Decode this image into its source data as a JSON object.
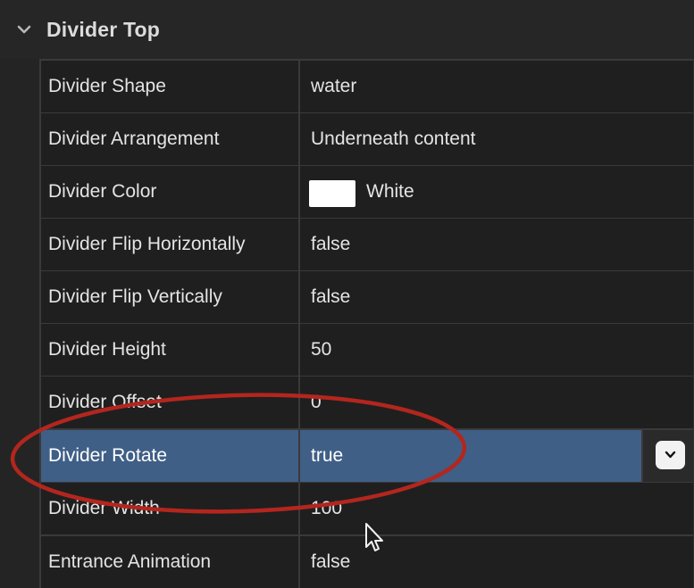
{
  "section": {
    "title": "Divider Top",
    "icon": "chevron-down-icon"
  },
  "properties": [
    {
      "name": "Divider Shape",
      "value": "water"
    },
    {
      "name": "Divider Arrangement",
      "value": "Underneath content"
    },
    {
      "name": "Divider Color",
      "value": "White",
      "swatch_color": "#ffffff"
    },
    {
      "name": "Divider Flip Horizontally",
      "value": "false"
    },
    {
      "name": "Divider Flip Vertically",
      "value": "false"
    },
    {
      "name": "Divider Height",
      "value": "50"
    },
    {
      "name": "Divider Offset",
      "value": "0"
    },
    {
      "name": "Divider Rotate",
      "value": "true",
      "selected": true,
      "control": "dropdown-chevron-icon"
    },
    {
      "name": "Divider Width",
      "value": "100"
    },
    {
      "name": "Entrance Animation",
      "value": "false"
    }
  ],
  "colors": {
    "selection": "#3f5f86",
    "annotation_ellipse": "#b3261e"
  }
}
